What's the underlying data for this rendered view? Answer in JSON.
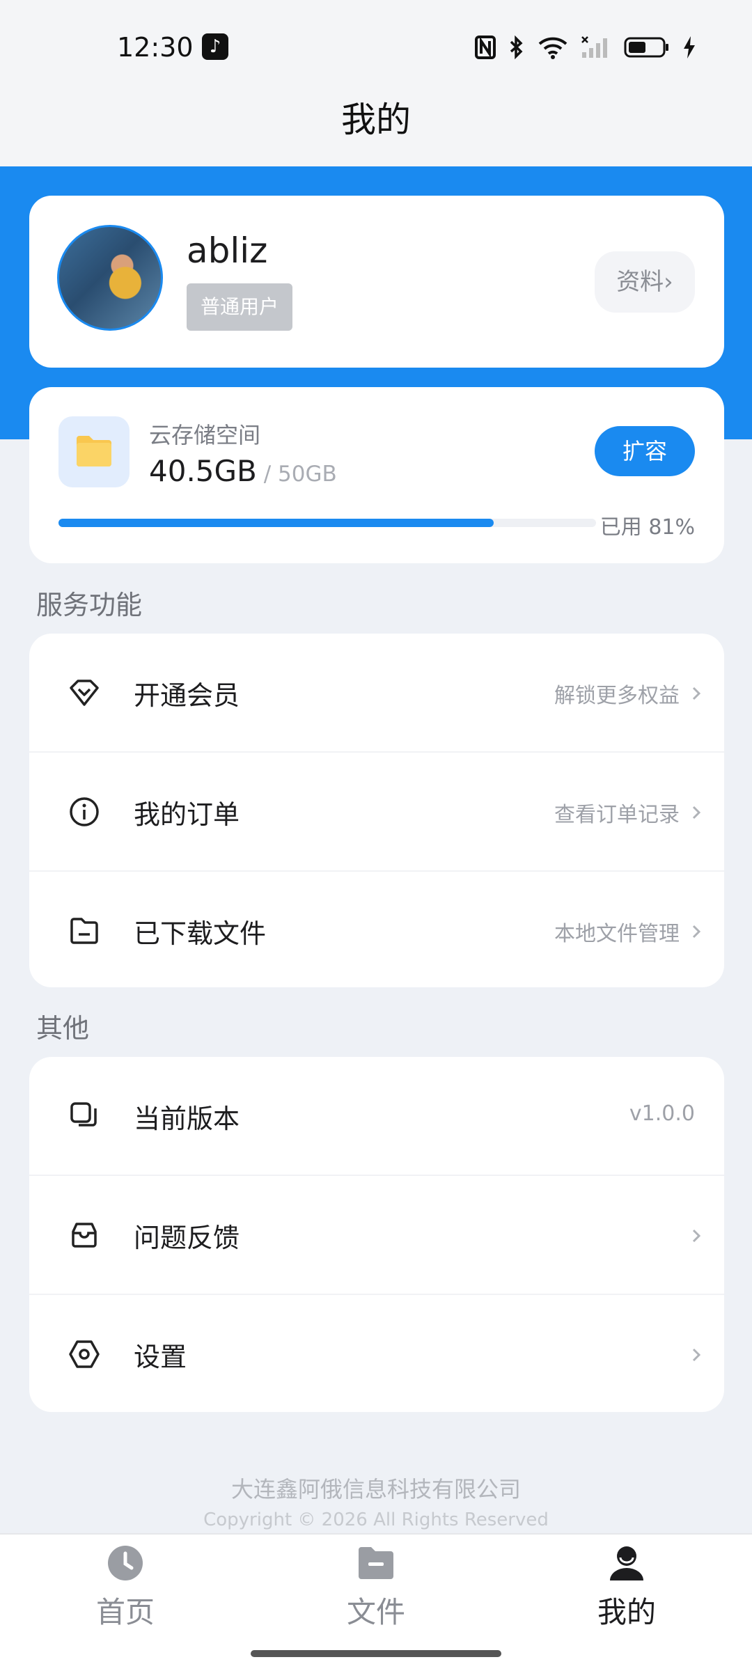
{
  "status_bar": {
    "time": "12:30"
  },
  "header": {
    "title": "我的"
  },
  "profile": {
    "username": "abliz",
    "badge": "普通用户",
    "profile_button": "资料›"
  },
  "storage": {
    "label": "云存储空间",
    "used": "40.5GB",
    "total": " / 50GB",
    "expand_button": "扩容",
    "used_percent_text": "已用 81%",
    "used_fraction": 0.81
  },
  "sections": {
    "services_title": "服务功能",
    "other_title": "其他"
  },
  "services": [
    {
      "label": "开通会员",
      "hint": "解锁更多权益",
      "icon": "diamond-icon"
    },
    {
      "label": "我的订单",
      "hint": "查看订单记录",
      "icon": "info-icon"
    },
    {
      "label": "已下载文件",
      "hint": "本地文件管理",
      "icon": "folder-minus-icon"
    }
  ],
  "others": [
    {
      "label": "当前版本",
      "hint": "v1.0.0",
      "icon": "layers-icon"
    },
    {
      "label": "问题反馈",
      "hint": "",
      "icon": "inbox-icon"
    },
    {
      "label": "设置",
      "hint": "",
      "icon": "settings-icon"
    }
  ],
  "footer": {
    "company": "大连鑫阿俄信息科技有限公司",
    "copyright": "Copyright © 2026 All Rights Reserved"
  },
  "tabs": [
    {
      "label": "首页",
      "icon": "clock-icon",
      "active": false
    },
    {
      "label": "文件",
      "icon": "folder-icon",
      "active": false
    },
    {
      "label": "我的",
      "icon": "person-icon",
      "active": true
    }
  ],
  "colors": {
    "accent": "#1a8af0",
    "background": "#eef1f6"
  }
}
